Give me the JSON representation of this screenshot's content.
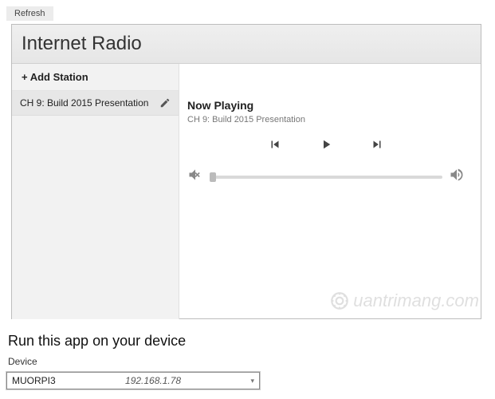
{
  "refresh_label": "Refresh",
  "app_title": "Internet Radio",
  "sidebar": {
    "add_label": "+ Add Station",
    "stations": [
      {
        "label": "CH 9: Build 2015 Presentation"
      }
    ]
  },
  "player": {
    "now_playing_label": "Now Playing",
    "current_track": "CH 9: Build 2015 Presentation"
  },
  "watermark_text": "uantrimang.com",
  "run_section": {
    "heading": "Run this app on your device",
    "device_label": "Device",
    "selected_device_name": "MUORPI3",
    "selected_device_ip": "192.168.1.78"
  }
}
